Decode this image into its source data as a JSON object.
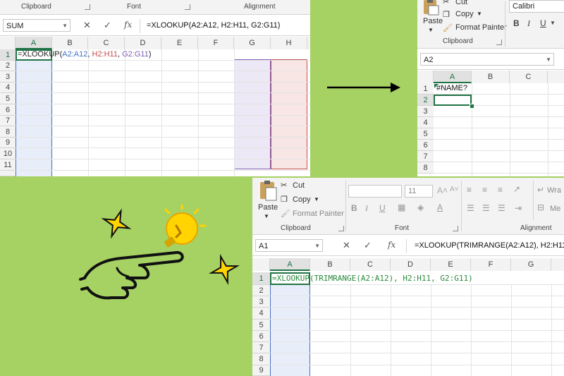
{
  "panel1": {
    "ribbon_groups": {
      "clipboard": "Clipboard",
      "font": "Font",
      "alignment": "Alignment"
    },
    "name_box": "SUM",
    "formula_bar": "=XLOOKUP(A2:A12, H2:H11, G2:G11)",
    "columns": [
      "A",
      "B",
      "C",
      "D",
      "E",
      "F",
      "G",
      "H"
    ],
    "rows": [
      "1",
      "2",
      "3",
      "4",
      "5",
      "6",
      "7",
      "8",
      "9",
      "10",
      "11"
    ],
    "cell_a1": {
      "prefix": "=XLOOKUP(",
      "ref1": "A2:A12",
      "sep1": ", ",
      "ref2": "H2:H11",
      "sep2": ", ",
      "ref3": "G2:G11",
      "suffix": ")"
    },
    "colors": {
      "ref1": "#4472c4",
      "ref2": "#c0504d",
      "ref3": "#7f5fb6"
    }
  },
  "panel2": {
    "clipboard": {
      "paste": "Paste",
      "cut": "Cut",
      "copy": "Copy",
      "format_painter": "Format Painter",
      "label": "Clipboard"
    },
    "font_name": "Calibri",
    "name_box": "A2",
    "columns": [
      "A",
      "B",
      "C"
    ],
    "rows": [
      "1",
      "2",
      "3",
      "4",
      "5",
      "6",
      "7",
      "8"
    ],
    "cell_a1": "#NAME?"
  },
  "panel3": {
    "clipboard": {
      "paste": "Paste",
      "cut": "Cut",
      "copy": "Copy",
      "format_painter": "Format Painter",
      "label": "Clipboard"
    },
    "font_size": "11",
    "font_label": "Font",
    "alignment_label": "Alignment",
    "wrap_partial": "Wra",
    "merge_partial": "Me",
    "name_box": "A1",
    "formula_bar": "=XLOOKUP(TRIMRANGE(A2:A12), H2:H11",
    "columns": [
      "A",
      "B",
      "C",
      "D",
      "E",
      "F",
      "G"
    ],
    "rows": [
      "1",
      "2",
      "3",
      "4",
      "5",
      "6",
      "7",
      "8",
      "9"
    ],
    "cell_a1": "=XLOOKUP(TRIMRANGE(A2:A12), H2:H11, G2:G11)"
  },
  "colors": {
    "background": "#a6d163",
    "excel_green": "#217346",
    "sparkle": "#ffd400"
  },
  "icons": [
    "arrow-right-icon",
    "pointing-hand-icon",
    "lightbulb-icon",
    "sparkle-icon",
    "cancel-icon",
    "enter-icon",
    "fx-icon",
    "paste-icon",
    "cut-icon",
    "copy-icon",
    "format-painter-icon"
  ]
}
